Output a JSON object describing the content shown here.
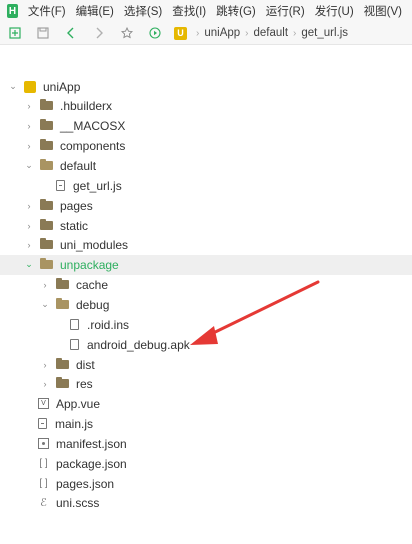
{
  "menubar": {
    "logo": "H",
    "items": [
      "文件(F)",
      "编辑(E)",
      "选择(S)",
      "查找(I)",
      "跳转(G)",
      "运行(R)",
      "发行(U)",
      "视图(V)"
    ]
  },
  "toolbar": {
    "icons": [
      "new-file-icon",
      "save-icon",
      "back-icon",
      "forward-icon",
      "star-icon",
      "run-icon"
    ],
    "breadcrumb": [
      "uniApp",
      "default",
      "get_url.js"
    ],
    "crumb_logo": "U"
  },
  "tree": {
    "root": "uniApp",
    "items": [
      {
        "label": ".hbuilderx"
      },
      {
        "label": "__MACOSX"
      },
      {
        "label": "components"
      },
      {
        "label": "default"
      },
      {
        "label": "get_url.js"
      },
      {
        "label": "pages"
      },
      {
        "label": "static"
      },
      {
        "label": "uni_modules"
      },
      {
        "label": "unpackage"
      },
      {
        "label": "cache"
      },
      {
        "label": "debug"
      },
      {
        "label": ".roid.ins"
      },
      {
        "label": "android_debug.apk"
      },
      {
        "label": "dist"
      },
      {
        "label": "res"
      },
      {
        "label": "App.vue"
      },
      {
        "label": "main.js"
      },
      {
        "label": "manifest.json"
      },
      {
        "label": "package.json"
      },
      {
        "label": "pages.json"
      },
      {
        "label": "uni.scss"
      }
    ]
  },
  "colors": {
    "accent_green": "#2eaf5f",
    "arrow_red": "#e53935",
    "project_yellow": "#e6b800"
  }
}
